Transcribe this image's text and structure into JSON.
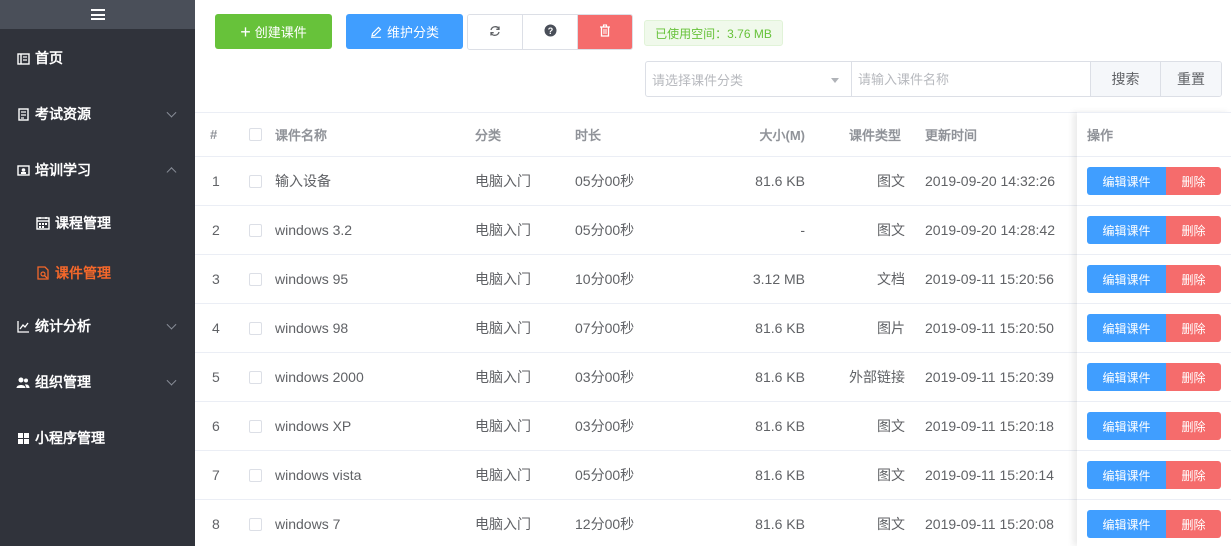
{
  "sidebar": {
    "menu": [
      {
        "label": "首页",
        "icon": "home-icon"
      },
      {
        "label": "考试资源",
        "icon": "document-icon"
      },
      {
        "label": "培训学习",
        "icon": "training-icon"
      },
      {
        "label": "课程管理",
        "icon": "calendar-icon"
      },
      {
        "label": "课件管理",
        "icon": "courseware-icon"
      },
      {
        "label": "统计分析",
        "icon": "chart-icon"
      },
      {
        "label": "组织管理",
        "icon": "users-icon"
      },
      {
        "label": "小程序管理",
        "icon": "apps-icon"
      }
    ]
  },
  "toolbar": {
    "create_label": "创建课件",
    "maintain_label": "维护分类",
    "space_label": "已使用空间：3.76 MB"
  },
  "search": {
    "category_placeholder": "请选择课件分类",
    "name_placeholder": "请输入课件名称",
    "search_label": "搜索",
    "reset_label": "重置"
  },
  "table": {
    "headers": {
      "index": "#",
      "name": "课件名称",
      "category": "分类",
      "duration": "时长",
      "size": "大小(M)",
      "type": "课件类型",
      "updated": "更新时间",
      "ops": "操作"
    },
    "edit_label": "编辑课件",
    "delete_label": "删除",
    "rows": [
      {
        "index": "1",
        "name": "输入设备",
        "category": "电脑入门",
        "duration": "05分00秒",
        "size": "81.6 KB",
        "type": "图文",
        "updated": "2019-09-20 14:32:26"
      },
      {
        "index": "2",
        "name": "windows 3.2",
        "category": "电脑入门",
        "duration": "05分00秒",
        "size": "-",
        "type": "图文",
        "updated": "2019-09-20 14:28:42"
      },
      {
        "index": "3",
        "name": "windows 95",
        "category": "电脑入门",
        "duration": "10分00秒",
        "size": "3.12 MB",
        "type": "文档",
        "updated": "2019-09-11 15:20:56"
      },
      {
        "index": "4",
        "name": "windows 98",
        "category": "电脑入门",
        "duration": "07分00秒",
        "size": "81.6 KB",
        "type": "图片",
        "updated": "2019-09-11 15:20:50"
      },
      {
        "index": "5",
        "name": "windows 2000",
        "category": "电脑入门",
        "duration": "03分00秒",
        "size": "81.6 KB",
        "type": "外部链接",
        "updated": "2019-09-11 15:20:39"
      },
      {
        "index": "6",
        "name": "windows XP",
        "category": "电脑入门",
        "duration": "03分00秒",
        "size": "81.6 KB",
        "type": "图文",
        "updated": "2019-09-11 15:20:18"
      },
      {
        "index": "7",
        "name": "windows vista",
        "category": "电脑入门",
        "duration": "05分00秒",
        "size": "81.6 KB",
        "type": "图文",
        "updated": "2019-09-11 15:20:14"
      },
      {
        "index": "8",
        "name": "windows 7",
        "category": "电脑入门",
        "duration": "12分00秒",
        "size": "81.6 KB",
        "type": "图文",
        "updated": "2019-09-11 15:20:08"
      }
    ]
  }
}
